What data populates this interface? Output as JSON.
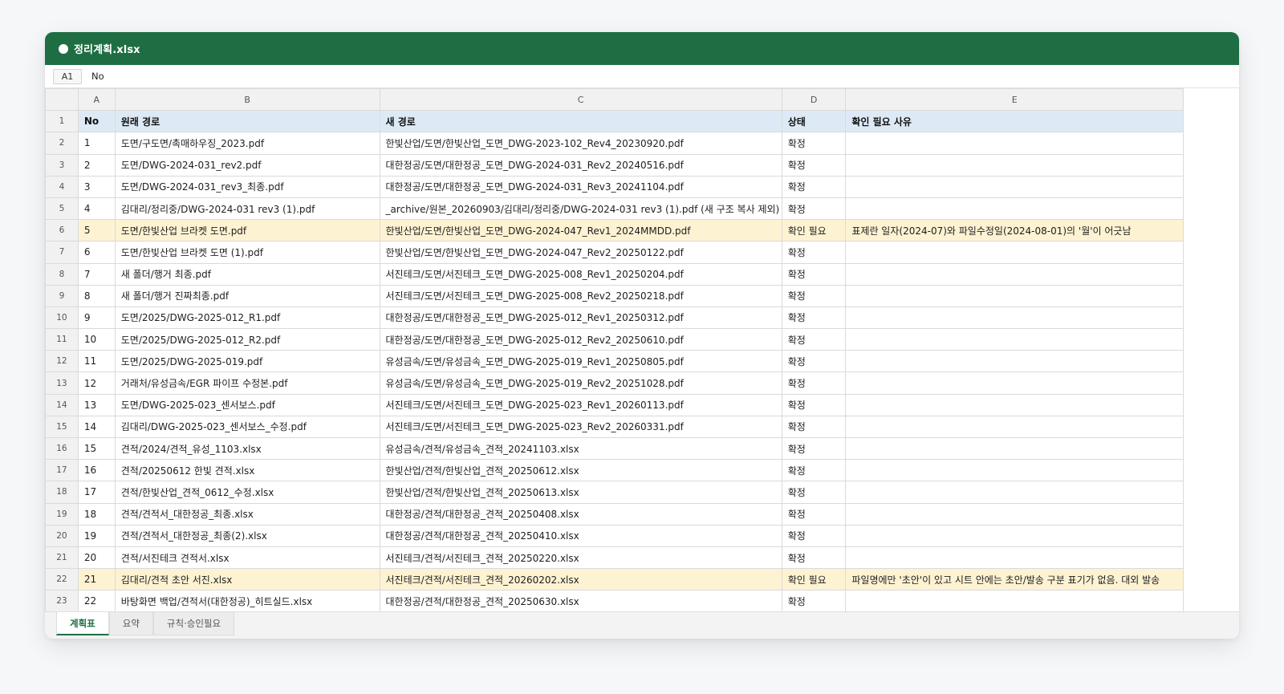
{
  "window": {
    "title": "정리계획.xlsx"
  },
  "formula_bar": {
    "cell_ref": "A1",
    "value": "No"
  },
  "columns": [
    "A",
    "B",
    "C",
    "D",
    "E"
  ],
  "rows": [
    {
      "n": "1",
      "flag": false,
      "header": true,
      "cells": [
        "No",
        "원래 경로",
        "새 경로",
        "상태",
        "확인 필요 사유"
      ]
    },
    {
      "n": "2",
      "flag": false,
      "header": false,
      "cells": [
        "1",
        "도면/구도면/촉매하우징_2023.pdf",
        "한빛산업/도면/한빛산업_도면_DWG-2023-102_Rev4_20230920.pdf",
        "확정",
        ""
      ]
    },
    {
      "n": "3",
      "flag": false,
      "header": false,
      "cells": [
        "2",
        "도면/DWG-2024-031_rev2.pdf",
        "대한정공/도면/대한정공_도면_DWG-2024-031_Rev2_20240516.pdf",
        "확정",
        ""
      ]
    },
    {
      "n": "4",
      "flag": false,
      "header": false,
      "cells": [
        "3",
        "도면/DWG-2024-031_rev3_최종.pdf",
        "대한정공/도면/대한정공_도면_DWG-2024-031_Rev3_20241104.pdf",
        "확정",
        ""
      ]
    },
    {
      "n": "5",
      "flag": false,
      "header": false,
      "cells": [
        "4",
        "김대리/정리중/DWG-2024-031 rev3 (1).pdf",
        "_archive/원본_20260903/김대리/정리중/DWG-2024-031 rev3 (1).pdf (새 구조 복사 제외)",
        "확정",
        ""
      ]
    },
    {
      "n": "6",
      "flag": true,
      "header": false,
      "cells": [
        "5",
        "도면/한빛산업 브라켓 도면.pdf",
        "한빛산업/도면/한빛산업_도면_DWG-2024-047_Rev1_2024MMDD.pdf",
        "확인 필요",
        "표제란 일자(2024-07)와 파일수정일(2024-08-01)의 '월'이 어긋남"
      ]
    },
    {
      "n": "7",
      "flag": false,
      "header": false,
      "cells": [
        "6",
        "도면/한빛산업 브라켓 도면 (1).pdf",
        "한빛산업/도면/한빛산업_도면_DWG-2024-047_Rev2_20250122.pdf",
        "확정",
        ""
      ]
    },
    {
      "n": "8",
      "flag": false,
      "header": false,
      "cells": [
        "7",
        "새 폴더/행거 최종.pdf",
        "서진테크/도면/서진테크_도면_DWG-2025-008_Rev1_20250204.pdf",
        "확정",
        ""
      ]
    },
    {
      "n": "9",
      "flag": false,
      "header": false,
      "cells": [
        "8",
        "새 폴더/행거 진짜최종.pdf",
        "서진테크/도면/서진테크_도면_DWG-2025-008_Rev2_20250218.pdf",
        "확정",
        ""
      ]
    },
    {
      "n": "10",
      "flag": false,
      "header": false,
      "cells": [
        "9",
        "도면/2025/DWG-2025-012_R1.pdf",
        "대한정공/도면/대한정공_도면_DWG-2025-012_Rev1_20250312.pdf",
        "확정",
        ""
      ]
    },
    {
      "n": "11",
      "flag": false,
      "header": false,
      "cells": [
        "10",
        "도면/2025/DWG-2025-012_R2.pdf",
        "대한정공/도면/대한정공_도면_DWG-2025-012_Rev2_20250610.pdf",
        "확정",
        ""
      ]
    },
    {
      "n": "12",
      "flag": false,
      "header": false,
      "cells": [
        "11",
        "도면/2025/DWG-2025-019.pdf",
        "유성금속/도면/유성금속_도면_DWG-2025-019_Rev1_20250805.pdf",
        "확정",
        ""
      ]
    },
    {
      "n": "13",
      "flag": false,
      "header": false,
      "cells": [
        "12",
        "거래처/유성금속/EGR 파이프 수정본.pdf",
        "유성금속/도면/유성금속_도면_DWG-2025-019_Rev2_20251028.pdf",
        "확정",
        ""
      ]
    },
    {
      "n": "14",
      "flag": false,
      "header": false,
      "cells": [
        "13",
        "도면/DWG-2025-023_센서보스.pdf",
        "서진테크/도면/서진테크_도면_DWG-2025-023_Rev1_20260113.pdf",
        "확정",
        ""
      ]
    },
    {
      "n": "15",
      "flag": false,
      "header": false,
      "cells": [
        "14",
        "김대리/DWG-2025-023_센서보스_수정.pdf",
        "서진테크/도면/서진테크_도면_DWG-2025-023_Rev2_20260331.pdf",
        "확정",
        ""
      ]
    },
    {
      "n": "16",
      "flag": false,
      "header": false,
      "cells": [
        "15",
        "견적/2024/견적_유성_1103.xlsx",
        "유성금속/견적/유성금속_견적_20241103.xlsx",
        "확정",
        ""
      ]
    },
    {
      "n": "17",
      "flag": false,
      "header": false,
      "cells": [
        "16",
        "견적/20250612 한빛 견적.xlsx",
        "한빛산업/견적/한빛산업_견적_20250612.xlsx",
        "확정",
        ""
      ]
    },
    {
      "n": "18",
      "flag": false,
      "header": false,
      "cells": [
        "17",
        "견적/한빛산업_견적_0612_수정.xlsx",
        "한빛산업/견적/한빛산업_견적_20250613.xlsx",
        "확정",
        ""
      ]
    },
    {
      "n": "19",
      "flag": false,
      "header": false,
      "cells": [
        "18",
        "견적/견적서_대한정공_최종.xlsx",
        "대한정공/견적/대한정공_견적_20250408.xlsx",
        "확정",
        ""
      ]
    },
    {
      "n": "20",
      "flag": false,
      "header": false,
      "cells": [
        "19",
        "견적/견적서_대한정공_최종(2).xlsx",
        "대한정공/견적/대한정공_견적_20250410.xlsx",
        "확정",
        ""
      ]
    },
    {
      "n": "21",
      "flag": false,
      "header": false,
      "cells": [
        "20",
        "견적/서진테크 견적서.xlsx",
        "서진테크/견적/서진테크_견적_20250220.xlsx",
        "확정",
        ""
      ]
    },
    {
      "n": "22",
      "flag": true,
      "header": false,
      "cells": [
        "21",
        "김대리/견적 초안 서진.xlsx",
        "서진테크/견적/서진테크_견적_20260202.xlsx",
        "확인 필요",
        "파일명에만 '초안'이 있고 시트 안에는 초안/발송 구분 표기가 없음. 대외 발송"
      ]
    },
    {
      "n": "23",
      "flag": false,
      "header": false,
      "cells": [
        "22",
        "바탕화면 백업/견적서(대한정공)_히트실드.xlsx",
        "대한정공/견적/대한정공_견적_20250630.xlsx",
        "확정",
        ""
      ]
    }
  ],
  "sheet_tabs": [
    {
      "label": "계획표",
      "active": true
    },
    {
      "label": "요약",
      "active": false
    },
    {
      "label": "규칙·승인필요",
      "active": false
    }
  ],
  "colors": {
    "titlebar": "#1f6e43",
    "header_fill": "#ddeaf6",
    "flag_fill": "#fdf2d2"
  }
}
